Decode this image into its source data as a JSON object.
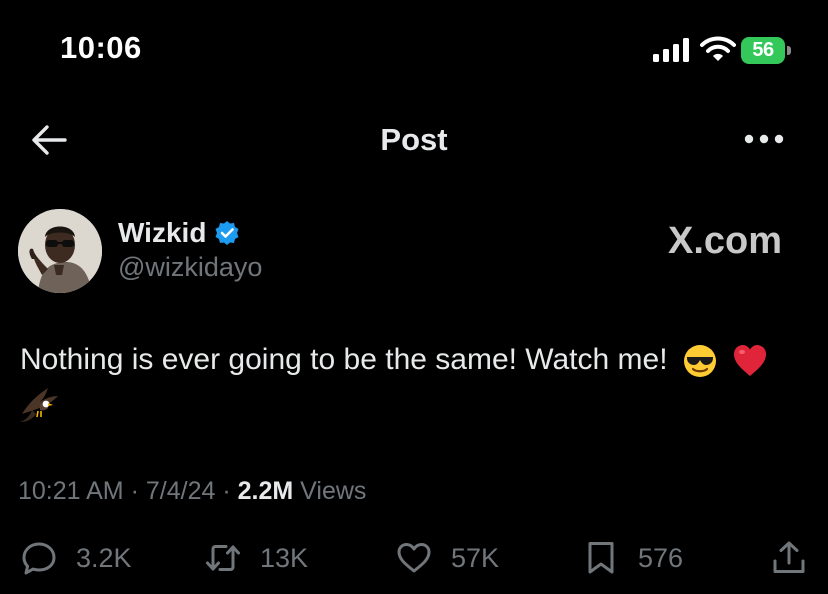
{
  "status_bar": {
    "time": "10:06",
    "battery": "56"
  },
  "nav": {
    "title": "Post"
  },
  "author": {
    "display_name": "Wizkid",
    "handle": "@wizkidayo",
    "verified": true
  },
  "brand_mark": "X.com",
  "tweet": {
    "text": "Nothing is ever going to be the same! Watch me!",
    "emojis": [
      "smiling-face-with-sunglasses",
      "red-heart",
      "eagle"
    ]
  },
  "meta": {
    "time": "10:21 AM",
    "date": "7/4/24",
    "views_count": "2.2M",
    "views_label": "Views"
  },
  "actions": {
    "replies": "3.2K",
    "reposts": "13K",
    "likes": "57K",
    "bookmarks": "576"
  },
  "colors": {
    "background": "#000000",
    "text": "#e7e9ea",
    "secondary": "#71767b",
    "verified": "#1d9bf0",
    "battery": "#34c759"
  }
}
